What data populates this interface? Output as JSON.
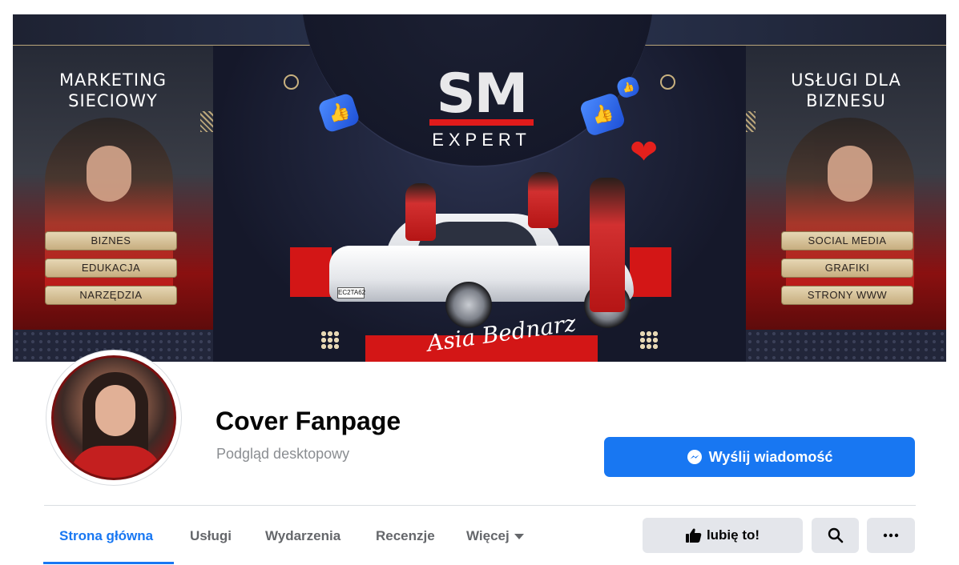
{
  "cover": {
    "left_title_line1": "MARKETING",
    "left_title_line2": "SIECIOWY",
    "left_pills": [
      "BIZNES",
      "EDUKACJA",
      "NARZĘDZIA"
    ],
    "right_title_line1": "USŁUGI DLA",
    "right_title_line2": "BIZNESU",
    "right_pills": [
      "SOCIAL MEDIA",
      "GRAFIKI",
      "STRONY WWW"
    ],
    "logo_main": "SM",
    "logo_sub": "EXPERT",
    "signature": "Asia Bednarz",
    "plate": "EC2TA62"
  },
  "profile": {
    "name": "Cover Fanpage",
    "subtitle": "Podgląd desktopowy"
  },
  "actions": {
    "message_label": "Wyślij wiadomość",
    "like_label": "lubię to!"
  },
  "tabs": [
    "Strona główna",
    "Usługi",
    "Wydarzenia",
    "Recenzje",
    "Więcej"
  ],
  "icons": {
    "message": "messenger-icon",
    "like": "thumbs-up-icon",
    "search": "search-icon",
    "more": "more-dots-icon",
    "dropdown": "caret-down-icon"
  },
  "colors": {
    "primary": "#1877f2",
    "button_gray": "#e4e6eb",
    "text_secondary": "#65676b",
    "accent_red": "#d31616",
    "accent_gold": "#c8b17f"
  }
}
